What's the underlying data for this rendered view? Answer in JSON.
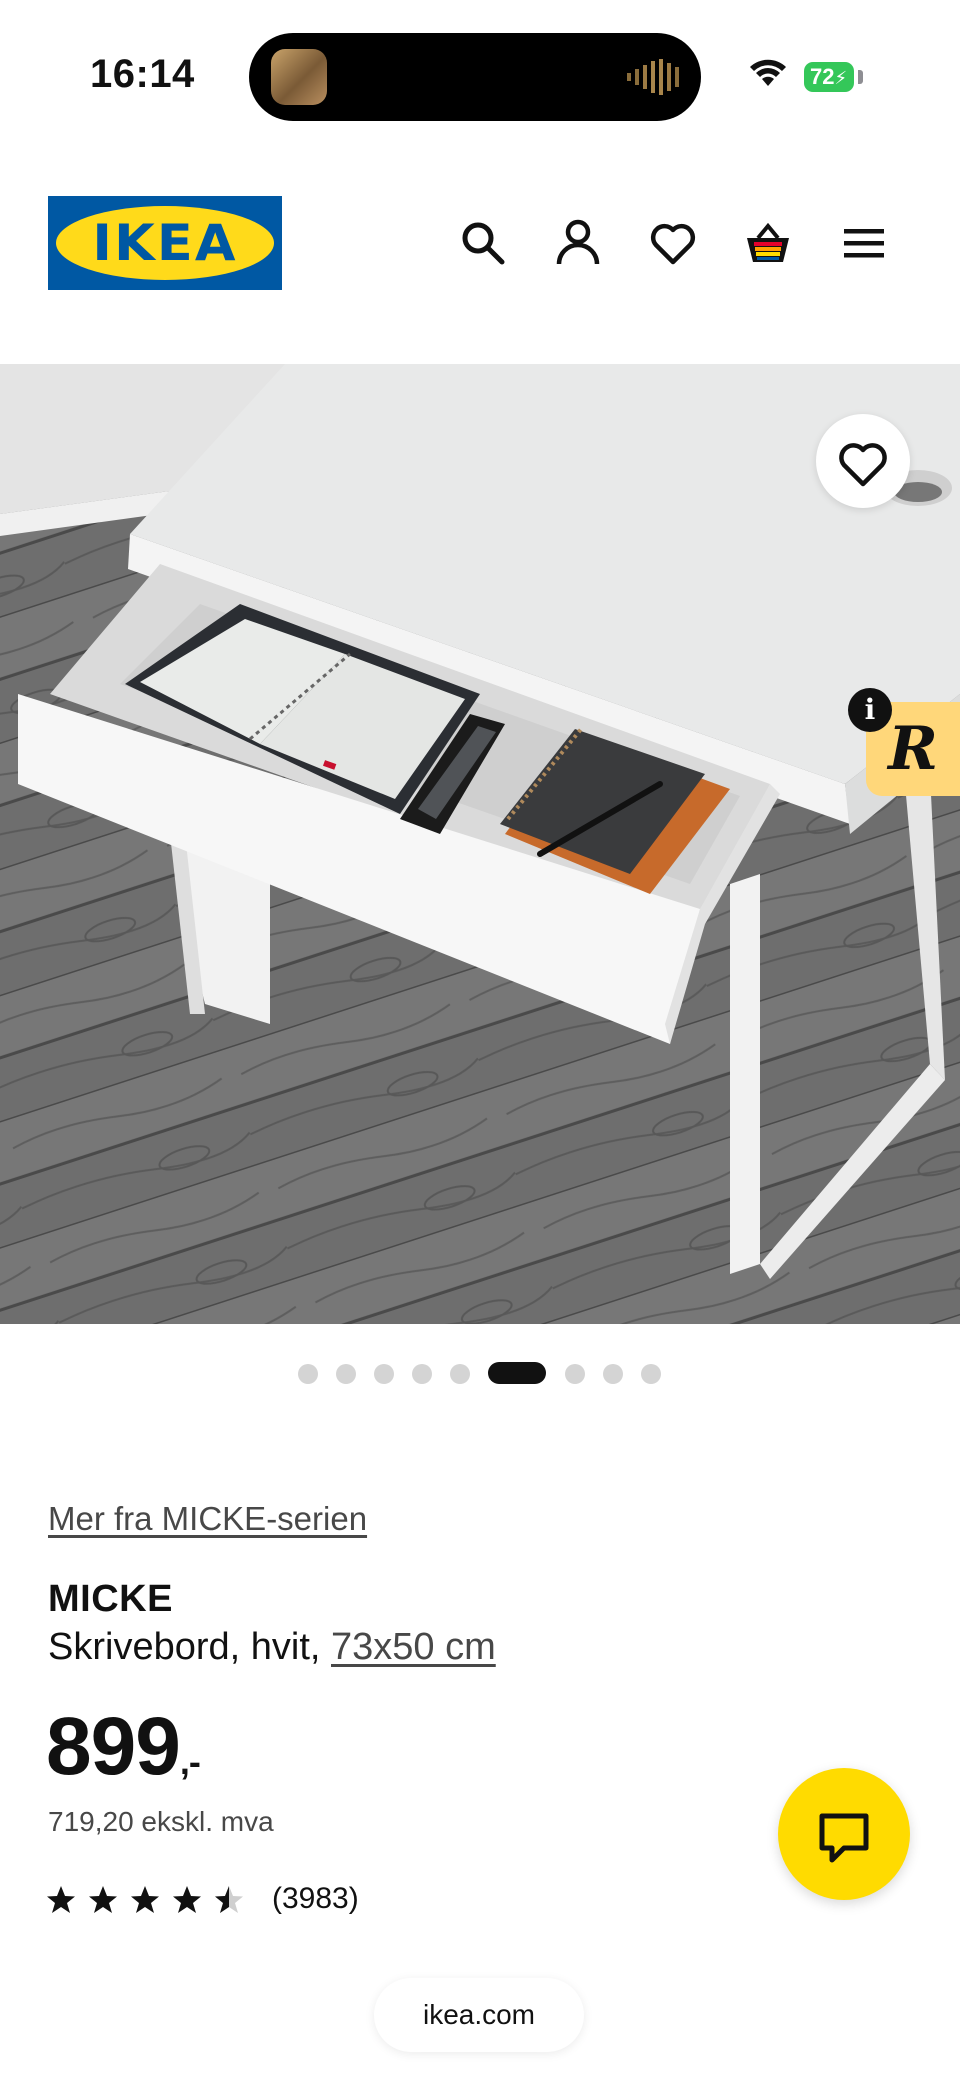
{
  "status_bar": {
    "time": "16:14",
    "battery": "72"
  },
  "header": {
    "logo_text": "IKEA",
    "icons": [
      "search-icon",
      "account-icon",
      "favourites-icon",
      "cart-icon",
      "menu-icon"
    ]
  },
  "gallery": {
    "image_count": 9,
    "active_index": 5
  },
  "product": {
    "series_link": "Mer fra MICKE-serien",
    "name": "MICKE",
    "description": "Skrivebord, hvit, ",
    "size": "73x50 cm",
    "price": "899",
    "price_suffix": ",-",
    "price_excl_vat": "719,20 ekskl. mva",
    "rating_stars": 4.5,
    "rating_count": "(3983)"
  },
  "extension_badge": {
    "letter": "R",
    "info": "i"
  },
  "browser": {
    "url": "ikea.com"
  },
  "colors": {
    "ikea_blue": "#0058a3",
    "ikea_yellow": "#ffda1a",
    "chat_yellow": "#ffdb00"
  }
}
